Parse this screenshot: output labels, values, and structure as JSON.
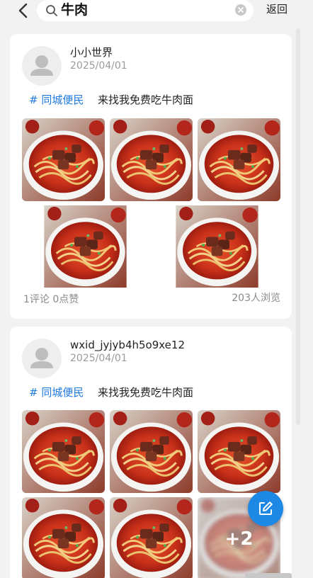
{
  "header": {
    "search_query": "牛肉",
    "cancel_label": "返回"
  },
  "posts": [
    {
      "username": "小小世界",
      "date": "2025/04/01",
      "tag": "# 同城便民",
      "content": "来找我免费吃牛肉面",
      "stats_left": "1评论 0点赞",
      "stats_right": "203人浏览"
    },
    {
      "username": "wxid_jyjyb4h5o9xe12",
      "date": "2025/04/01",
      "tag": "# 同城便民",
      "content": "来找我免费吃牛肉面",
      "more_count": "+2"
    }
  ],
  "colors": {
    "accent": "#1f7ae0",
    "fab": "#1e88e5"
  },
  "icons": {
    "back": "chevron-left-icon",
    "search": "search-icon",
    "clear": "clear-icon",
    "avatar": "person-icon",
    "compose": "edit-icon"
  }
}
